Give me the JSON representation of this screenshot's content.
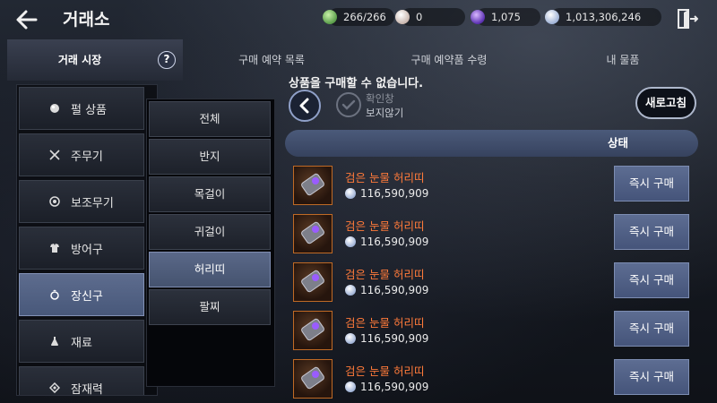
{
  "header": {
    "title": "거래소",
    "currencies": [
      {
        "icon": "green-stone-icon",
        "value": "266/266",
        "color": "#7ad26b"
      },
      {
        "icon": "pearl-icon",
        "value": "0",
        "color": "#e8e0dc"
      },
      {
        "icon": "purple-orb-icon",
        "value": "1,075",
        "color": "#7a4dd8"
      },
      {
        "icon": "silver-coin-icon",
        "value": "1,013,306,246",
        "color": "#c9d6f0"
      }
    ]
  },
  "tabs": [
    {
      "label": "거래 시장",
      "active": true
    },
    {
      "label": "구매 예약 목록",
      "active": false
    },
    {
      "label": "구매 예약품 수령",
      "active": false
    },
    {
      "label": "내 물품",
      "active": false
    }
  ],
  "help_label": "?",
  "categories": [
    {
      "label": "펄 상품",
      "icon": "pearl-icon"
    },
    {
      "label": "주무기",
      "icon": "crossed-swords-icon"
    },
    {
      "label": "보조무기",
      "icon": "target-icon"
    },
    {
      "label": "방어구",
      "icon": "armor-icon"
    },
    {
      "label": "장신구",
      "icon": "ring-icon",
      "active": true
    },
    {
      "label": "재료",
      "icon": "flask-icon"
    },
    {
      "label": "잠재력",
      "icon": "diamond-icon"
    }
  ],
  "subcategories": [
    {
      "label": "전체"
    },
    {
      "label": "반지"
    },
    {
      "label": "목걸이"
    },
    {
      "label": "귀걸이"
    },
    {
      "label": "허리띠",
      "active": true
    },
    {
      "label": "팔찌"
    }
  ],
  "notice": "상품을 구매할 수 없습니다.",
  "hide_check": {
    "line1": "확인창",
    "line2": "보지않기"
  },
  "refresh_label": "새로고침",
  "status_label": "상태",
  "items": [
    {
      "name": "검은 눈물 허리띠",
      "price": "116,590,909",
      "buy_label": "즉시 구매"
    },
    {
      "name": "검은 눈물 허리띠",
      "price": "116,590,909",
      "buy_label": "즉시 구매"
    },
    {
      "name": "검은 눈물 허리띠",
      "price": "116,590,909",
      "buy_label": "즉시 구매"
    },
    {
      "name": "검은 눈물 허리띠",
      "price": "116,590,909",
      "buy_label": "즉시 구매"
    },
    {
      "name": "검은 눈물 허리띠",
      "price": "116,590,909",
      "buy_label": "즉시 구매"
    }
  ],
  "colors": {
    "item_name": "#ff7a3a",
    "active_tab": "#5d6c8e",
    "buy_button": "#55648a"
  }
}
